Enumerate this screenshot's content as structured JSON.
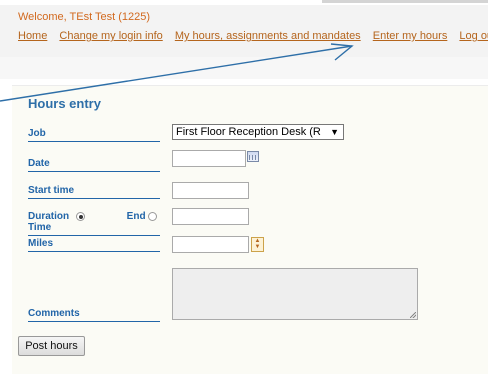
{
  "header": {
    "welcome": "Welcome, TEst Test (1225)",
    "nav": [
      {
        "label": "Home"
      },
      {
        "label": "Change my login info"
      },
      {
        "label": "My hours, assignments and mandates"
      },
      {
        "label": "Enter my hours"
      },
      {
        "label": "Log out"
      }
    ]
  },
  "form": {
    "title": "Hours entry",
    "job_label": "Job",
    "job_value": "First Floor Reception Desk (R",
    "date_label": "Date",
    "start_time_label": "Start time",
    "duration_label": "Duration",
    "end_time_label": "End Time",
    "miles_label": "Miles",
    "comments_label": "Comments",
    "submit_label": "Post hours"
  },
  "colors": {
    "link": "#b5651d",
    "label": "#2265a8",
    "title": "#2e6fa8",
    "annotation_arrow": "#2e6fa8"
  }
}
